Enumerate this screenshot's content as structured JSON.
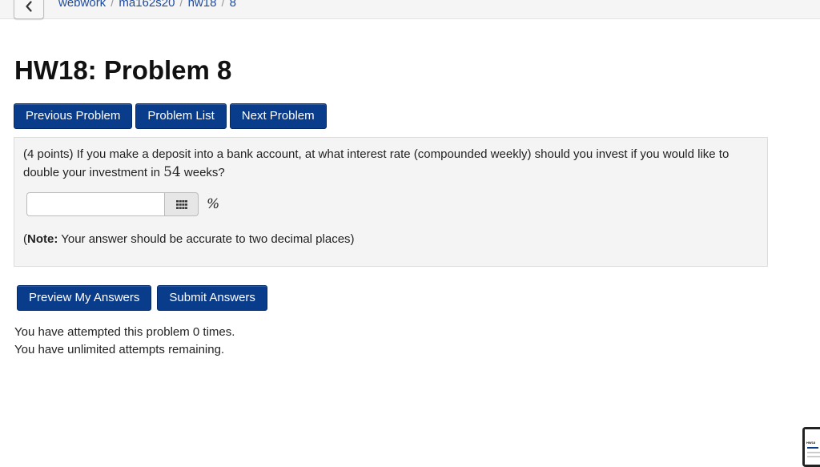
{
  "breadcrumb": {
    "items": [
      "webwork",
      "ma162s20",
      "hw18"
    ],
    "current": "8",
    "separator": "/"
  },
  "page": {
    "title": "HW18: Problem 8"
  },
  "nav": {
    "previous_label": "Previous Problem",
    "list_label": "Problem List",
    "next_label": "Next Problem"
  },
  "problem": {
    "points": "(4 points)",
    "text_before": " If you make a deposit into a bank account, at what interest rate (compounded weekly) should you invest if you would like to double your investment in ",
    "weeks": "54",
    "text_after": " weeks?",
    "answer_value": "",
    "unit": "%",
    "note_label": "Note:",
    "note_text": " Your answer should be accurate to two decimal places)",
    "note_open": "("
  },
  "actions": {
    "preview_label": "Preview My Answers",
    "submit_label": "Submit Answers"
  },
  "status": {
    "attempts": "You have attempted this problem 0 times.",
    "remaining": "You have unlimited attempts remaining."
  },
  "thumbnail": {
    "label": "HW18"
  },
  "colors": {
    "button_primary": "#0a3c8c",
    "link": "#1d4a9f",
    "problem_background": "#f4f4f4"
  }
}
